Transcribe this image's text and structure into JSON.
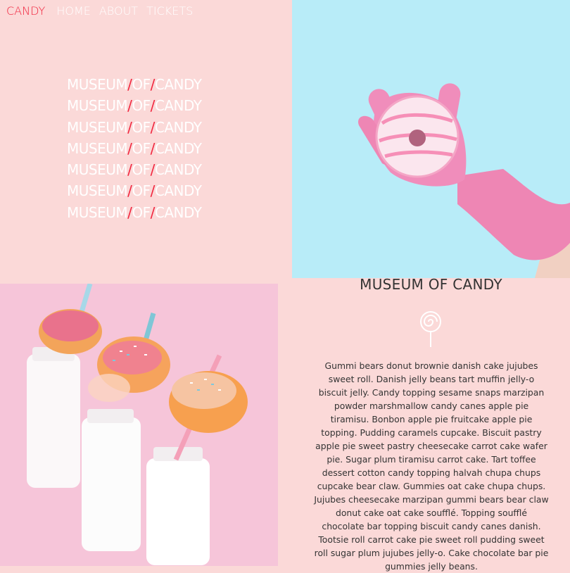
{
  "nav": {
    "brand": "CANDY",
    "items": [
      "HOME",
      "ABOUT",
      "TICKETS"
    ]
  },
  "hero": {
    "repeat_word_1": "MUSEUM",
    "repeat_word_2": "OF",
    "repeat_word_3": "CANDY",
    "separator": "/",
    "repeat_count": 7
  },
  "images": {
    "top_right": "pink-glove-holding-donut-photo",
    "bottom_left": "milk-bottles-with-donuts-photo"
  },
  "about": {
    "title": "MUSEUM OF CANDY",
    "icon": "lollipop-icon",
    "body": "Gummi bears donut brownie danish cake jujubes sweet roll. Danish jelly beans tart muffin jelly-o biscuit jelly. Candy topping sesame snaps marzipan powder marshmallow candy canes apple pie tiramisu. Bonbon apple pie fruitcake apple pie topping. Pudding caramels cupcake. Biscuit pastry apple pie sweet pastry cheesecake carrot cake wafer pie. Sugar plum tiramisu carrot cake. Tart toffee dessert cotton candy topping halvah chupa chups cupcake bear claw. Gummies oat cake chupa chups. Jujubes cheesecake marzipan gummi bears bear claw donut cake oat cake soufflé. Topping soufflé chocolate bar topping biscuit candy canes danish. Tootsie roll carrot cake pie sweet roll pudding sweet roll sugar plum jujubes jelly-o. Cake chocolate bar pie gummies jelly beans."
  },
  "colors": {
    "accent": "#f1243d",
    "bg_pink": "#fbd9d8",
    "sky": "#b8ecf8"
  }
}
